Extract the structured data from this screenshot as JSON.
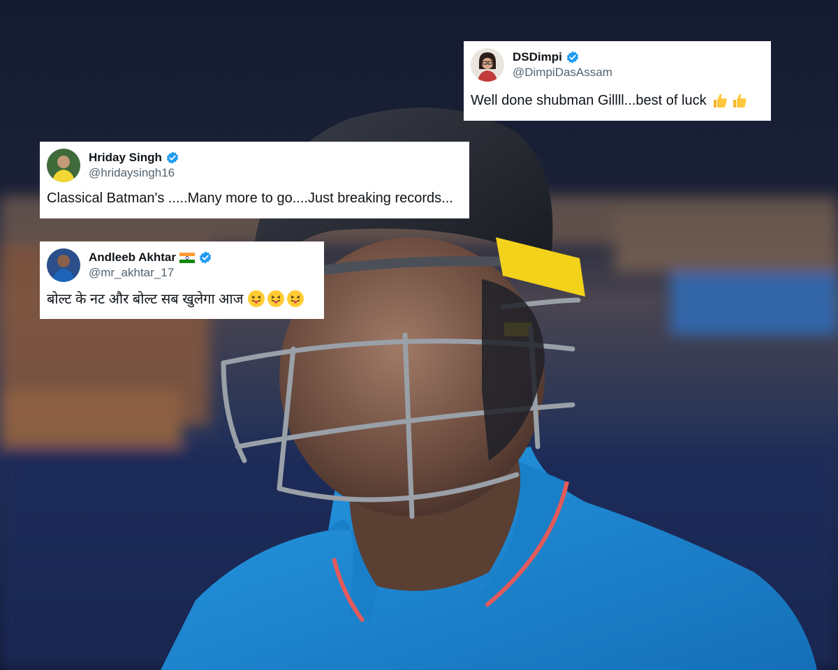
{
  "tweets": [
    {
      "name": "Hriday Singh",
      "handle": "@hridaysingh16",
      "text": "Classical Batman's .....Many more to go....Just breaking records...",
      "verified": true,
      "emojis": []
    },
    {
      "name": "Andleeb Akhtar",
      "handle": "@mr_akhtar_17",
      "text": "बोल्ट के नट और बोल्ट सब खुलेगा आज",
      "verified": true,
      "flag": "india-flag-icon",
      "emojis": [
        "face-with-tongue-icon",
        "face-with-tongue-icon",
        "face-with-tongue-icon"
      ]
    },
    {
      "name": "DSDimpi",
      "handle": "@DimpiDasAssam",
      "text": "Well done shubman Gillll...best of luck",
      "verified": true,
      "emojis": [
        "thumbs-up-icon",
        "thumbs-up-icon"
      ]
    }
  ],
  "colors": {
    "verified_blue": "#1d9bf0",
    "jersey_blue": "#1e8fd8",
    "helmet_dark": "#262932",
    "grille_yellow": "#f3d21b"
  }
}
